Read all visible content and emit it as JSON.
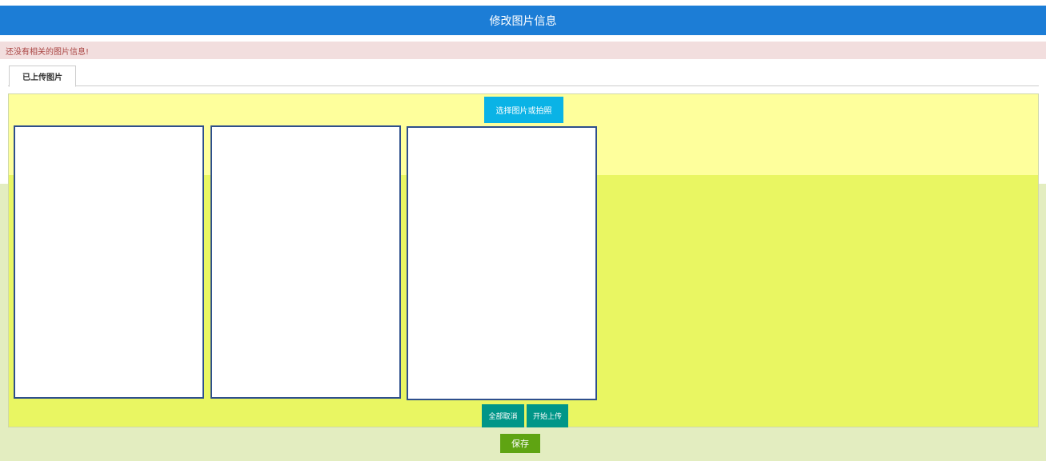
{
  "header": {
    "title": "修改图片信息"
  },
  "alert": {
    "message": "还没有相关的图片信息!"
  },
  "tabs": [
    {
      "label": "已上传图片"
    }
  ],
  "uploader": {
    "select_label": "选择图片或拍照",
    "cancel_all_label": "全部取消",
    "start_upload_label": "开始上传"
  },
  "form": {
    "save_label": "保存"
  },
  "colors": {
    "header": "#1c7dd6",
    "alert_bg": "#f2dede",
    "alert_text": "#a94442",
    "select_button": "#0ab3e6",
    "upload_buttons": "#009688",
    "save_button": "#5fa412",
    "frame_border": "#2e4f8c"
  }
}
